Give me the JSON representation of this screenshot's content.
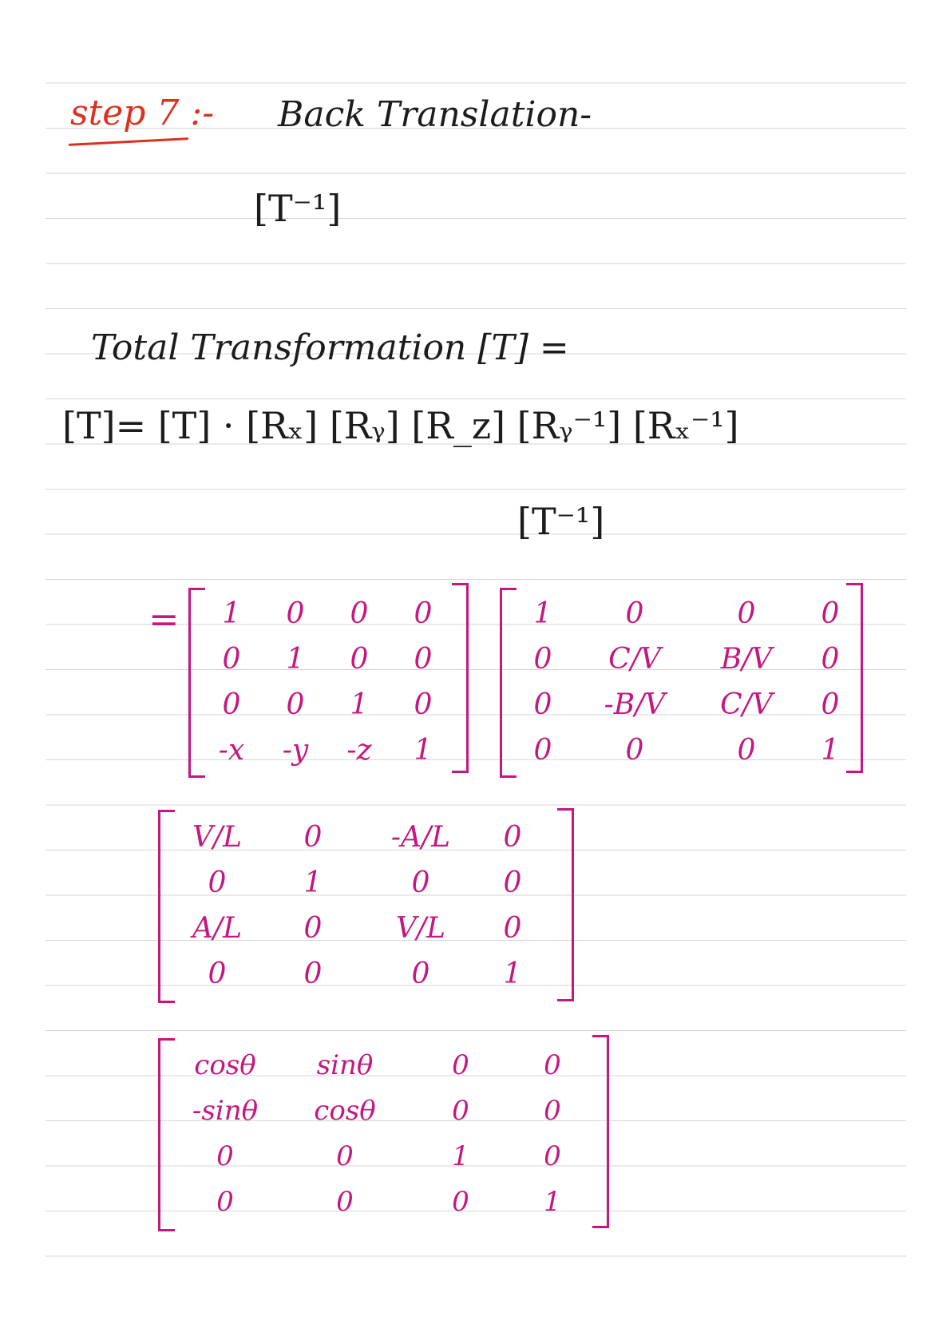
{
  "heading": {
    "step_label": "step 7 :-",
    "title": "Back Translation-"
  },
  "t_inverse_label": "[T⁻¹]",
  "total": {
    "label": "Total Transformation [T] =",
    "equation": "[T]= [T] · [Rₓ] [Rᵧ] [R_z] [Rᵧ⁻¹] [Rₓ⁻¹]",
    "equation_tail": "[T⁻¹]"
  },
  "equals_sign": "=",
  "matrices": {
    "translation": [
      [
        "1",
        "0",
        "0",
        "0"
      ],
      [
        "0",
        "1",
        "0",
        "0"
      ],
      [
        "0",
        "0",
        "1",
        "0"
      ],
      [
        "-x",
        "-y",
        "-z",
        "1"
      ]
    ],
    "rx": [
      [
        "1",
        "0",
        "0",
        "0"
      ],
      [
        "0",
        "C/V",
        "B/V",
        "0"
      ],
      [
        "0",
        "-B/V",
        "C/V",
        "0"
      ],
      [
        "0",
        "0",
        "0",
        "1"
      ]
    ],
    "ry": [
      [
        "V/L",
        "0",
        "-A/L",
        "0"
      ],
      [
        "0",
        "1",
        "0",
        "0"
      ],
      [
        "A/L",
        "0",
        "V/L",
        "0"
      ],
      [
        "0",
        "0",
        "0",
        "1"
      ]
    ],
    "rz": [
      [
        "cosθ",
        "sinθ",
        "0",
        "0"
      ],
      [
        "-sinθ",
        "cosθ",
        "0",
        "0"
      ],
      [
        "0",
        "0",
        "1",
        "0"
      ],
      [
        "0",
        "0",
        "0",
        "1"
      ]
    ]
  },
  "colors": {
    "heading_ink": "#d9321f",
    "body_ink": "#1c1c1c",
    "matrix_ink": "#c4177f",
    "rule_line": "#d6d6d6"
  }
}
